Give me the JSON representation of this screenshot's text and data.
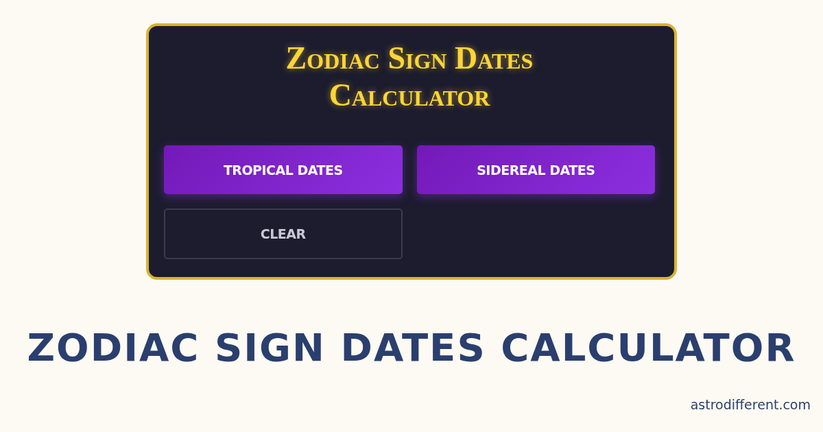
{
  "calculator": {
    "title": "Zodiac Sign Dates Calculator",
    "buttons": [
      {
        "label": "TROPICAL DATES",
        "kind": "primary"
      },
      {
        "label": "SIDEREAL DATES",
        "kind": "primary"
      },
      {
        "label": "CLEAR",
        "kind": "outline"
      }
    ]
  },
  "headline": "ZODIAC SIGN DATES CALCULATOR",
  "site": "astrodifferent.com"
}
